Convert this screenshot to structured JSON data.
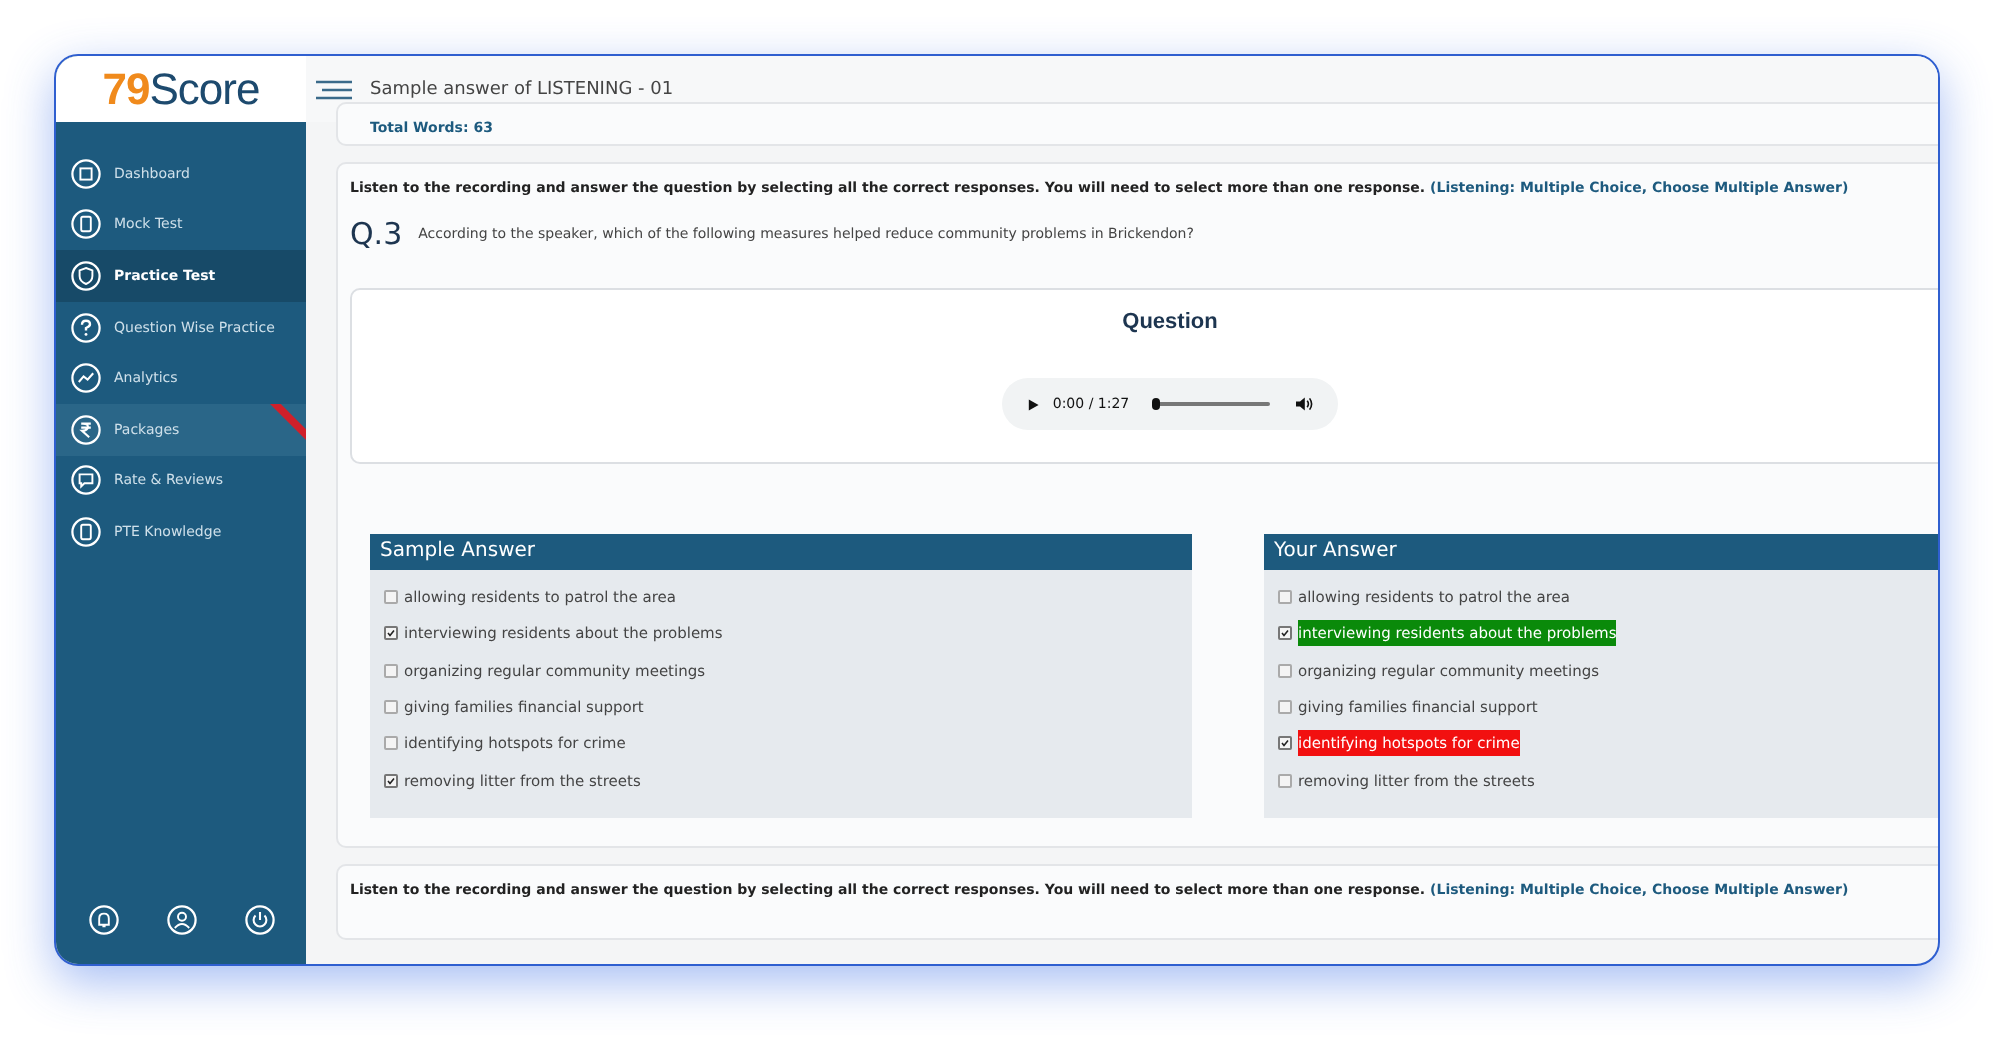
{
  "logo": {
    "digits": "79",
    "word": "Score"
  },
  "header": {
    "title": "Sample answer of LISTENING - 01"
  },
  "sidebar": {
    "items": [
      {
        "label": "Dashboard",
        "selected": false,
        "ribbon": false
      },
      {
        "label": "Mock Test",
        "selected": false,
        "ribbon": false
      },
      {
        "label": "Practice Test",
        "selected": true,
        "ribbon": false
      },
      {
        "label": "Question Wise Practice",
        "selected": false,
        "ribbon": false
      },
      {
        "label": "Analytics",
        "selected": false,
        "ribbon": false
      },
      {
        "label": "Packages",
        "selected": false,
        "ribbon": true
      },
      {
        "label": "Rate & Reviews",
        "selected": false,
        "ribbon": false
      },
      {
        "label": "PTE Knowledge",
        "selected": false,
        "ribbon": false
      }
    ]
  },
  "previous": {
    "total_words": "Total Words: 63"
  },
  "question": {
    "instruction": "Listen to the recording and answer the question by selecting all the correct responses. You will need to select more than one response.",
    "type": "(Listening: Multiple Choice, Choose Multiple Answer)",
    "number": "Q.3",
    "text": "According to the speaker, which of the following measures helped reduce community problems in Brickendon?",
    "audio": {
      "heading": "Question",
      "time": "0:00 / 1:27",
      "level": 0
    },
    "sample": {
      "title": "Sample Answer",
      "options": [
        {
          "label": "allowing residents to patrol the area",
          "checked": false
        },
        {
          "label": "interviewing residents about the problems",
          "checked": true
        },
        {
          "label": "organizing regular community meetings",
          "checked": false
        },
        {
          "label": "giving families financial support",
          "checked": false
        },
        {
          "label": "identifying hotspots for crime",
          "checked": false
        },
        {
          "label": "removing litter from the streets",
          "checked": true
        }
      ]
    },
    "yours": {
      "title": "Your Answer",
      "options": [
        {
          "label": "allowing residents to patrol the area",
          "checked": false
        },
        {
          "label": "interviewing residents about the problems",
          "checked": true,
          "color": "#0a8a0a"
        },
        {
          "label": "organizing regular community meetings",
          "checked": false
        },
        {
          "label": "giving families financial support",
          "checked": false
        },
        {
          "label": "identifying hotspots for crime",
          "checked": true,
          "color": "#f21010"
        },
        {
          "label": "removing litter from the streets",
          "checked": false
        }
      ]
    }
  },
  "next": {
    "instruction": "Listen to the recording and answer the question by selecting all the correct responses. You will need to select more than one response.",
    "type": "(Listening: Multiple Choice, Choose Multiple Answer)"
  }
}
